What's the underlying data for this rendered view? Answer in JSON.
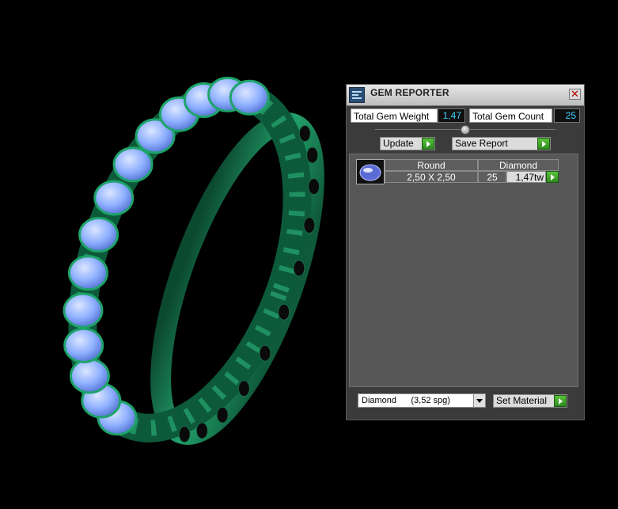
{
  "window": {
    "title": "GEM REPORTER",
    "close_glyph": "✕"
  },
  "stats": {
    "total_weight_label": "Total Gem Weight",
    "total_weight_value": "1,47",
    "total_count_label": "Total Gem Count",
    "total_count_value": "25"
  },
  "buttons": {
    "update": "Update",
    "save_report": "Save Report",
    "set_material": "Set Material"
  },
  "table": {
    "shape": "Round",
    "material": "Diamond",
    "size": "2,50 X 2,50",
    "count": "25",
    "weight": "1,47tw"
  },
  "material_dropdown": {
    "selected": "Diamond      (3,52 spg)"
  },
  "icons": [
    "app-icon",
    "close-icon",
    "splitter-knob-icon",
    "go-arrow-icon",
    "gem-thumbnail",
    "chevron-down-icon"
  ],
  "colors": {
    "metal": "#1e8a5c",
    "gem": "#8fb4ff",
    "value_text": "#3fd2ff",
    "go_button": "#3fa82a"
  }
}
